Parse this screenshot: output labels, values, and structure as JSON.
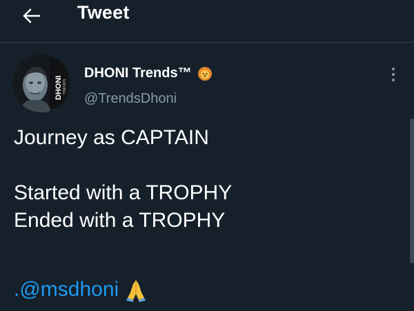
{
  "header": {
    "title": "Tweet"
  },
  "author": {
    "display_name": "DHONI Trends™",
    "handle": "@TrendsDhoni",
    "avatar_text_main": "DHONI",
    "avatar_text_sub": "TRENDS"
  },
  "tweet": {
    "body": "Journey as CAPTAIN\n\nStarted with a TROPHY\nEnded with a TROPHY",
    "mention_prefix": ".",
    "mention": "@msdhoni"
  },
  "colors": {
    "background": "#15202b",
    "accent": "#1d9bf0",
    "muted": "#8899a6"
  },
  "icons": {
    "back": "arrow-left-icon",
    "badge": "lion-emoji-icon",
    "more": "more-vertical-icon",
    "emoji": "folded-hands-emoji-icon"
  }
}
